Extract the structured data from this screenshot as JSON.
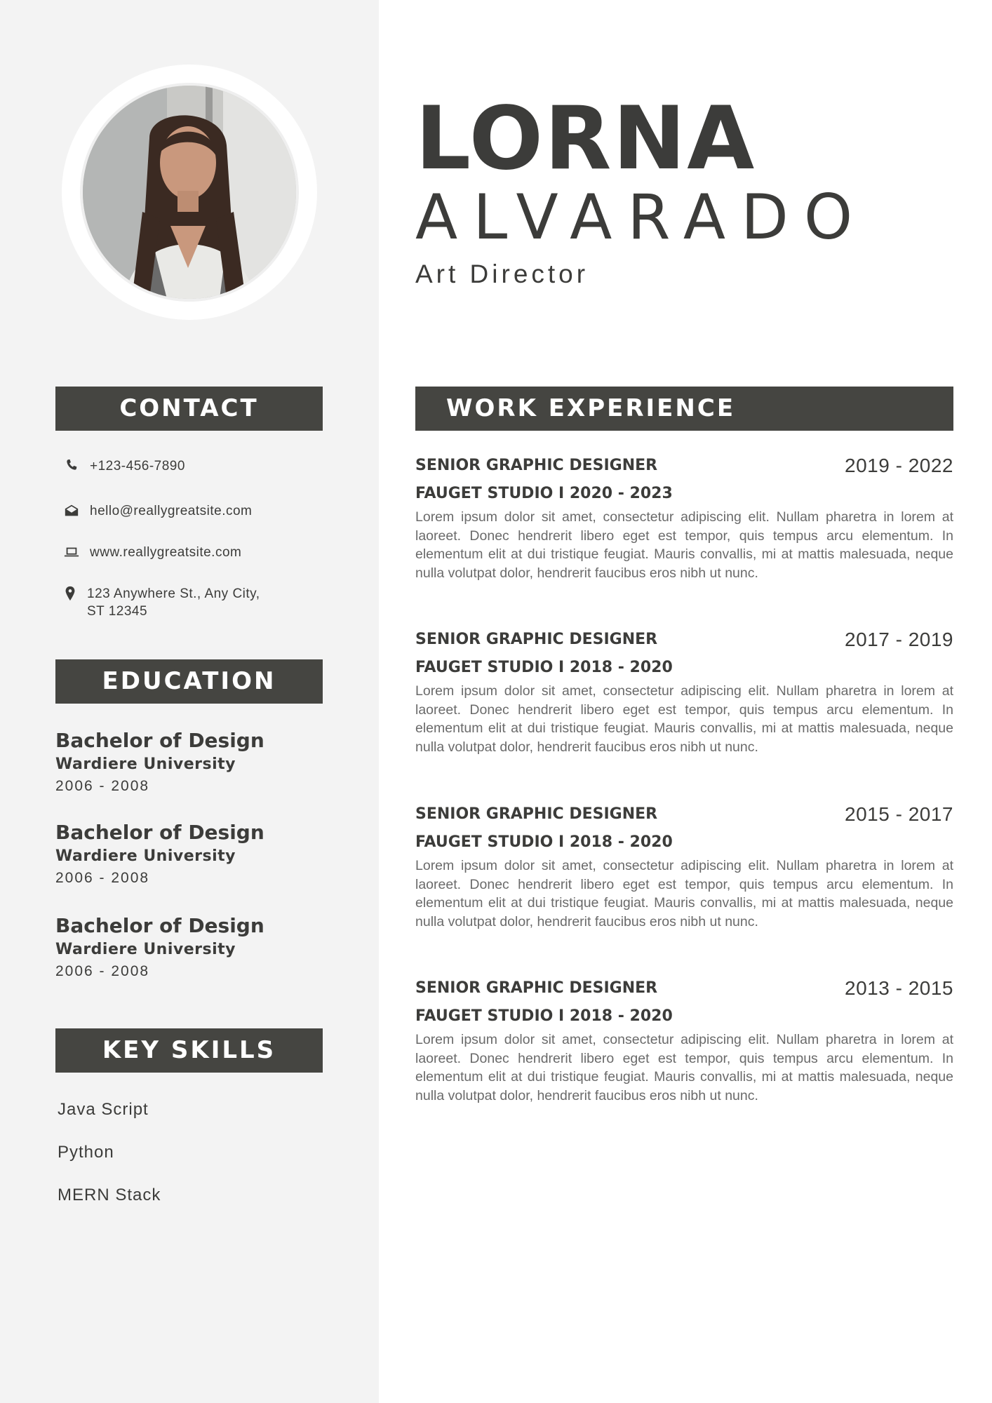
{
  "profile": {
    "first_name": "LORNA",
    "last_name": "ALVARADO",
    "role": "Art Director"
  },
  "contact": {
    "heading": "CONTACT",
    "phone": "+123-456-7890",
    "email": "hello@reallygreatsite.com",
    "website": "www.reallygreatsite.com",
    "address_line1": "123 Anywhere St., Any City,",
    "address_line2": "ST 12345"
  },
  "education": {
    "heading": "EDUCATION",
    "items": [
      {
        "degree": "Bachelor of Design",
        "school": "Wardiere University",
        "years": "2006 - 2008"
      },
      {
        "degree": "Bachelor of Design",
        "school": "Wardiere University",
        "years": "2006 - 2008"
      },
      {
        "degree": "Bachelor of Design",
        "school": "Wardiere University",
        "years": "2006 - 2008"
      }
    ]
  },
  "skills": {
    "heading": "KEY SKILLS",
    "items": [
      "Java Script",
      "Python",
      "MERN Stack"
    ]
  },
  "work": {
    "heading": "WORK EXPERIENCE",
    "items": [
      {
        "title": "SENIOR GRAPHIC DESIGNER",
        "years": "2019 - 2022",
        "company": "FAUGET STUDIO I 2020 - 2023",
        "desc": "Lorem ipsum dolor sit amet, consectetur adipiscing elit. Nullam pharetra in lorem at laoreet. Donec hendrerit libero eget est tempor, quis tempus arcu elementum. In elementum elit at dui tristique feugiat. Mauris convallis, mi at mattis malesuada, neque nulla volutpat dolor, hendrerit faucibus eros nibh ut nunc."
      },
      {
        "title": "SENIOR GRAPHIC DESIGNER",
        "years": "2017 - 2019",
        "company": "FAUGET STUDIO I 2018 - 2020",
        "desc": "Lorem ipsum dolor sit amet, consectetur adipiscing elit. Nullam pharetra in lorem at laoreet. Donec hendrerit libero eget est tempor, quis tempus arcu elementum. In elementum elit at dui tristique feugiat. Mauris convallis, mi at mattis malesuada, neque nulla volutpat dolor, hendrerit faucibus eros nibh ut nunc."
      },
      {
        "title": "SENIOR GRAPHIC DESIGNER",
        "years": "2015 - 2017",
        "company": "FAUGET STUDIO I 2018 - 2020",
        "desc": "Lorem ipsum dolor sit amet, consectetur adipiscing elit. Nullam pharetra in lorem at laoreet. Donec hendrerit libero eget est tempor, quis tempus arcu elementum. In elementum elit at dui tristique feugiat. Mauris convallis, mi at mattis malesuada, neque nulla volutpat dolor, hendrerit faucibus eros nibh ut nunc."
      },
      {
        "title": "SENIOR GRAPHIC DESIGNER",
        "years": "2013 - 2015",
        "company": "FAUGET STUDIO I 2018 - 2020",
        "desc": "Lorem ipsum dolor sit amet, consectetur adipiscing elit. Nullam pharetra in lorem at laoreet. Donec hendrerit libero eget est tempor, quis tempus arcu elementum. In elementum elit at dui tristique feugiat. Mauris convallis, mi at mattis malesuada, neque nulla volutpat dolor, hendrerit faucibus eros nibh ut nunc."
      }
    ]
  },
  "icons": {
    "phone": "phone-icon",
    "email": "envelope-icon",
    "website": "laptop-icon",
    "address": "map-pin-icon"
  },
  "colors": {
    "sidebar_bg": "#f3f3f3",
    "bar_bg": "#454541",
    "text": "#3c3c3a",
    "body_text": "#6a6a6a"
  }
}
